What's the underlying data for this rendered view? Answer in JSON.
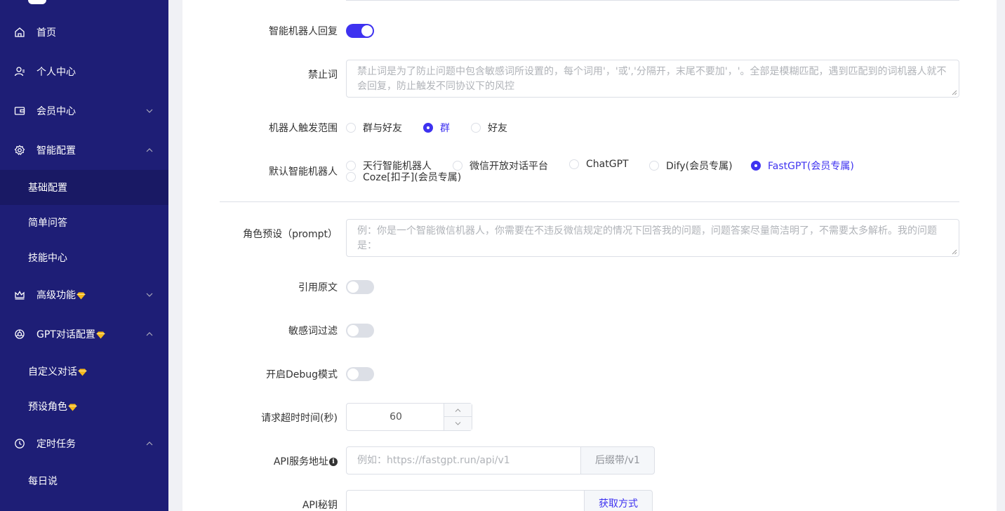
{
  "sidebar": {
    "items": [
      {
        "label": "首页",
        "icon": "home-icon"
      },
      {
        "label": "个人中心",
        "icon": "user-icon"
      },
      {
        "label": "会员中心",
        "icon": "wallet-icon"
      },
      {
        "label": "智能配置",
        "icon": "gear-icon"
      },
      {
        "label": "基础配置"
      },
      {
        "label": "简单问答"
      },
      {
        "label": "技能中心"
      },
      {
        "label": "高级功能",
        "icon": "crown-icon"
      },
      {
        "label": "GPT对话配置",
        "icon": "openai-icon"
      },
      {
        "label": "自定义对话"
      },
      {
        "label": "预设角色"
      },
      {
        "label": "定时任务",
        "icon": "clock-icon"
      },
      {
        "label": "每日说"
      }
    ],
    "active": "基础配置",
    "accent_color": "#1e1e76",
    "premium_icon": "diamond-icon"
  },
  "form": {
    "smart_reply": {
      "label": "智能机器人回复",
      "on": true
    },
    "banned_words": {
      "label": "禁止词",
      "placeholder": "禁止词是为了防止问题中包含敏感词所设置的，每个词用'，'或','分隔开，末尾不要加'，'。全部是模糊匹配，遇到匹配到的词机器人就不会回复，防止触发不同协议下的风控"
    },
    "trigger_scope": {
      "label": "机器人触发范围",
      "options": [
        "群与好友",
        "群",
        "好友"
      ],
      "selected": "群"
    },
    "default_bot": {
      "label": "默认智能机器人",
      "options": [
        "天行智能机器人",
        "微信开放对话平台",
        "ChatGPT",
        "Dify(会员专属)",
        "FastGPT(会员专属)",
        "Coze[扣子](会员专属)"
      ],
      "selected": "FastGPT(会员专属)"
    },
    "prompt": {
      "label": "角色预设（prompt）",
      "placeholder": "例：你是一个智能微信机器人，你需要在不违反微信规定的情况下回答我的问题，问题答案尽量简洁明了，不需要太多解析。我的问题是："
    },
    "quote_original": {
      "label": "引用原文",
      "on": false
    },
    "sensitive_filter": {
      "label": "敏感词过滤",
      "on": false
    },
    "debug_mode": {
      "label": "开启Debug模式",
      "on": false
    },
    "timeout": {
      "label": "请求超时时间(秒)",
      "value": "60"
    },
    "api_url": {
      "label": "API服务地址",
      "placeholder": "例如：https://fastgpt.run/api/v1",
      "suffix": "后缀带/v1"
    },
    "api_key": {
      "label": "API秘钥",
      "value": "",
      "action": "获取方式"
    }
  },
  "colors": {
    "primary": "#3e32f0",
    "sidebar": "#1e1e76"
  }
}
